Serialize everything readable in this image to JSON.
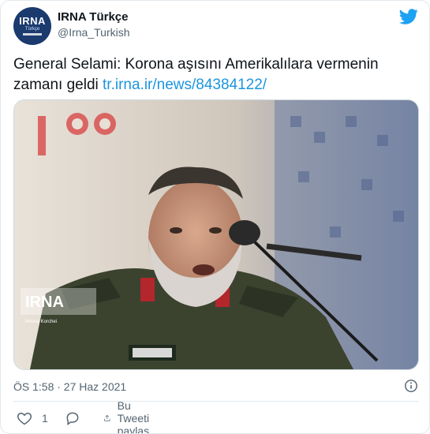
{
  "account": {
    "display_name": "IRNA Türkçe",
    "handle": "@Irna_Turkish",
    "avatar_logo": "IRNA",
    "avatar_sub": "Türkçe"
  },
  "tweet": {
    "text": "General Selami: Korona aşısını Amerikalılara vermenin zamanı geldi ",
    "link": "tr.irna.ir/news/84384122/"
  },
  "media": {
    "watermark": "IRNA",
    "watermark_credit": "Moosa Korchei"
  },
  "meta": {
    "time_date": "ÖS 1:58 · 27 Haz 2021"
  },
  "actions": {
    "like_count": "1",
    "share_label": "Bu Tweeti paylaş"
  },
  "icons": {
    "twitter": "twitter-bird-icon",
    "info": "info-icon",
    "like": "heart-icon",
    "reply": "reply-bubble-icon",
    "share": "share-icon"
  },
  "colors": {
    "twitter_blue": "#1da1f2",
    "link": "#1b95e0",
    "muted": "#536471"
  }
}
